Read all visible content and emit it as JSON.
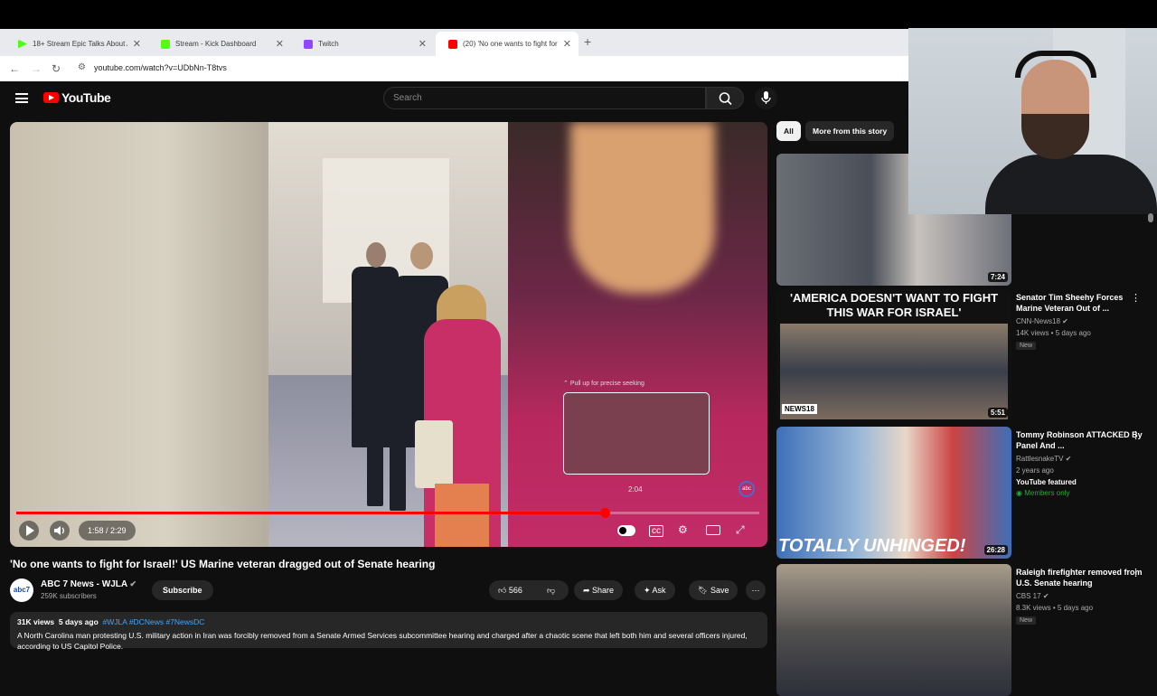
{
  "browser": {
    "tabs": [
      {
        "title": "18+ Stream Epic Talks About A",
        "favicon_color": "#53fc18"
      },
      {
        "title": "Stream - Kick Dashboard",
        "favicon_color": "#53fc18"
      },
      {
        "title": "Twitch",
        "favicon_color": "#9146ff"
      },
      {
        "title": "(20) 'No one wants to fight for",
        "favicon_color": "#ff0000",
        "active": true
      }
    ],
    "url": "youtube.com/watch?v=UDbNn-T8tvs"
  },
  "youtube": {
    "logo_text": "YouTube",
    "search_placeholder": "Search"
  },
  "player": {
    "current_time": "1:58",
    "duration": "2:29",
    "time_display": "1:58 / 2:29",
    "progress_fraction": 0.792,
    "preview_label": "Pull up for precise seeking",
    "preview_time": "2:04",
    "abc_logo": "abc"
  },
  "video": {
    "title": "'No one wants to fight for Israel!' US Marine veteran dragged out of Senate hearing",
    "channel": "ABC 7 News - WJLA",
    "subscribers": "259K subscribers",
    "subscribe_label": "Subscribe",
    "likes": "566",
    "share_label": "Share",
    "ask_label": "Ask",
    "save_label": "Save",
    "views": "31K views",
    "age": "5 days ago",
    "hashtags": "#WJLA #DCNews #7NewsDC",
    "description": "A North Carolina man protesting U.S. military action in Iran was forcibly removed from a Senate Armed Services subcommittee hearing and charged after a chaotic scene that left both him and several officers injured, according to US Capitol Police."
  },
  "chips": [
    "All",
    "More from this story"
  ],
  "recommendations": [
    {
      "title": "",
      "channel": "",
      "meta": "",
      "duration": "7:24"
    },
    {
      "title": "Senator Tim Sheehy Forces Marine Veteran Out of ...",
      "channel": "CNN-News18",
      "meta": "14K views • 5 days ago",
      "badge": "New",
      "duration": "5:51",
      "thumb_text": "'AMERICA DOESN'T WANT TO FIGHT THIS WAR FOR ISRAEL'",
      "thumb_logo": "NEWS18"
    },
    {
      "title": "Tommy Robinson ATTACKED By Panel And ...",
      "channel": "RattlesnakeTV",
      "meta": "2 years ago",
      "featured": "YouTube featured",
      "members": "Members only",
      "duration": "26:28",
      "thumb_text": "TOTALLY UNHINGED!"
    },
    {
      "title": "Raleigh firefighter removed from U.S. Senate hearing",
      "channel": "CBS 17",
      "meta": "8.3K views • 5 days ago",
      "badge": "New"
    }
  ]
}
